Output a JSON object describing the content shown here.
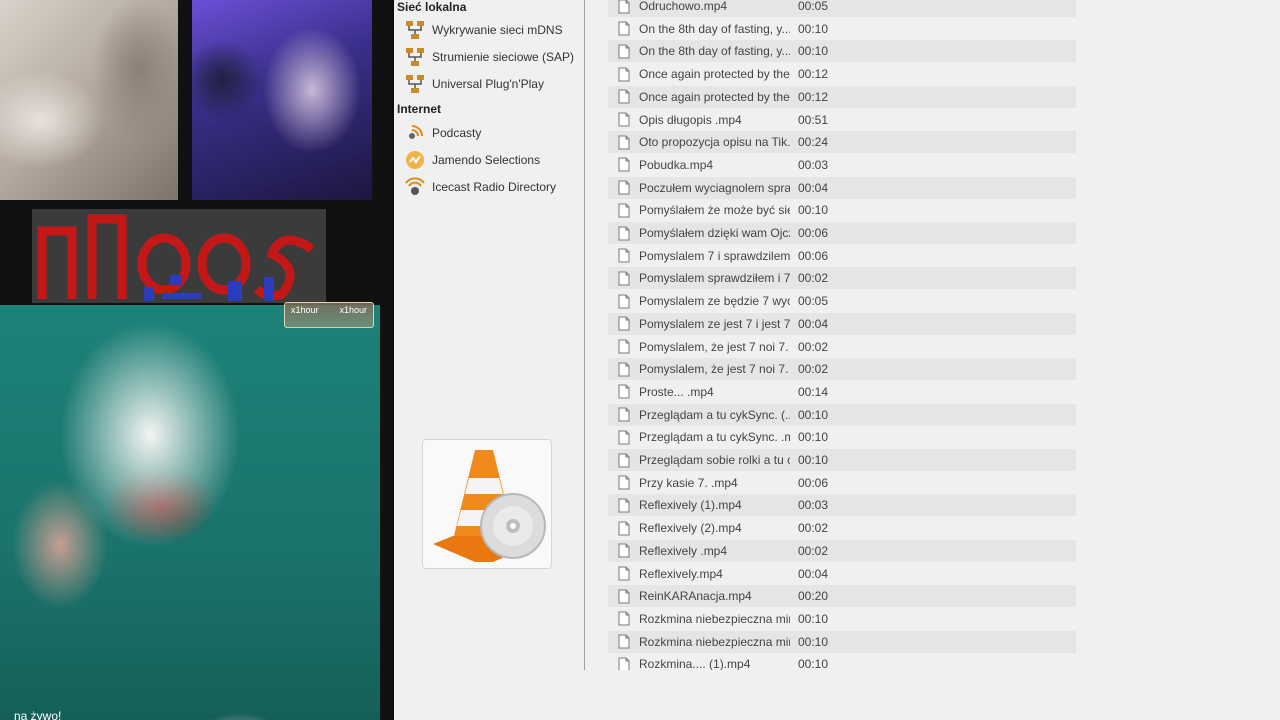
{
  "video_overlay": {
    "x1hour_left": "x1hour",
    "x1hour_right": "x1hour",
    "caption": "na żywo!"
  },
  "sidebar": {
    "local_network_heading": "Sieć lokalna",
    "local_items": [
      {
        "label": "Wykrywanie sieci mDNS",
        "icon": "network-icon"
      },
      {
        "label": "Strumienie sieciowe (SAP)",
        "icon": "network-icon"
      },
      {
        "label": "Universal Plug'n'Play",
        "icon": "network-icon"
      }
    ],
    "internet_heading": "Internet",
    "internet_items": [
      {
        "label": "Podcasty",
        "icon": "podcast-icon"
      },
      {
        "label": "Jamendo Selections",
        "icon": "jamendo-icon"
      },
      {
        "label": "Icecast Radio Directory",
        "icon": "icecast-icon"
      }
    ]
  },
  "playlist": {
    "rows": [
      {
        "title": "Odruchowo.mp4",
        "duration": "00:05"
      },
      {
        "title": "On the 8th day of fasting, y...",
        "duration": "00:10"
      },
      {
        "title": "On the 8th day of fasting, y...",
        "duration": "00:10"
      },
      {
        "title": "Once again protected by the...",
        "duration": "00:12"
      },
      {
        "title": "Once again protected by the...",
        "duration": "00:12"
      },
      {
        "title": "Opis długopis .mp4",
        "duration": "00:51"
      },
      {
        "title": "Oto propozycja opisu na Tik...",
        "duration": "00:24"
      },
      {
        "title": "Pobudka.mp4",
        "duration": "00:03"
      },
      {
        "title": "Poczułem wyciagnolem spra...",
        "duration": "00:04"
      },
      {
        "title": "Pomyślałem że może być sie...",
        "duration": "00:10"
      },
      {
        "title": "Pomyślałem dzięki wam Ojcz...",
        "duration": "00:06"
      },
      {
        "title": "Pomyslalem 7 i sprawdzilem i ...",
        "duration": "00:06"
      },
      {
        "title": "Pomyslalem sprawdziłem i 7....",
        "duration": "00:02"
      },
      {
        "title": "Pomyslalem ze będzie 7 wyci...",
        "duration": "00:05"
      },
      {
        "title": "Pomyslalem ze jest 7 i jest 7 ...",
        "duration": "00:04"
      },
      {
        "title": "Pomyslalem, że jest 7 noi 7. ...",
        "duration": "00:02"
      },
      {
        "title": "Pomyslalem, że jest 7 noi 7. ...",
        "duration": "00:02"
      },
      {
        "title": "Proste... .mp4",
        "duration": "00:14"
      },
      {
        "title": "Przeglądam a tu cykSync.  (...",
        "duration": "00:10"
      },
      {
        "title": "Przeglądam a tu cykSync. .m...",
        "duration": "00:10"
      },
      {
        "title": "Przeglądam sobie rolki a tu c...",
        "duration": "00:10"
      },
      {
        "title": "Przy kasie 7. .mp4",
        "duration": "00:06"
      },
      {
        "title": "Reflexively  (1).mp4",
        "duration": "00:03"
      },
      {
        "title": "Reflexively  (2).mp4",
        "duration": "00:02"
      },
      {
        "title": "Reflexively .mp4",
        "duration": "00:02"
      },
      {
        "title": "Reflexively.mp4",
        "duration": "00:04"
      },
      {
        "title": "ReinKARAnacja.mp4",
        "duration": "00:20"
      },
      {
        "title": "Rozkmina niebezpieczna min...",
        "duration": "00:10"
      },
      {
        "title": "Rozkmina niebezpieczna min...",
        "duration": "00:10"
      },
      {
        "title": "Rozkmina....  (1).mp4",
        "duration": "00:10"
      }
    ]
  },
  "colors": {
    "panel_bg": "#f0f0f0",
    "row_alt_bg": "#e5e5e5",
    "vlc_orange": "#f08a1c",
    "teal_video": "#1a736b"
  }
}
